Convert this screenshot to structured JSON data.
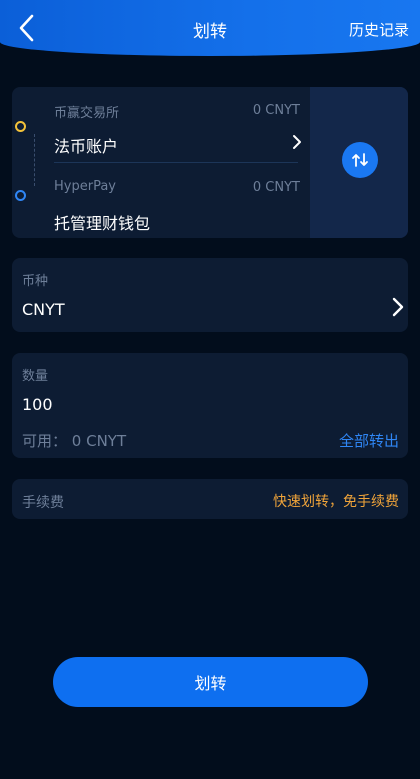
{
  "header": {
    "title": "划转",
    "history_label": "历史记录"
  },
  "transfer": {
    "from_exchange": "币赢交易所",
    "from_balance": "0 CNYT",
    "from_account": "法币账户",
    "to_exchange": "HyperPay",
    "to_balance": "0 CNYT",
    "to_account": "托管理财钱包"
  },
  "coin": {
    "label": "币种",
    "value": "CNYT"
  },
  "amount": {
    "label": "数量",
    "value": "100",
    "available_label": "可用：",
    "available_value": "0 CNYT",
    "all_label": "全部转出"
  },
  "fee": {
    "label": "手续费",
    "note": "快速划转，免手续费"
  },
  "submit_label": "划转",
  "colors": {
    "accent": "#1a78f2",
    "background": "#020d1c",
    "card": "#0d1c33",
    "fee_note": "#f0a43a"
  },
  "icons": {
    "back": "chevron-left-icon",
    "swap": "swap-icon",
    "arrow": "chevron-right-icon"
  }
}
